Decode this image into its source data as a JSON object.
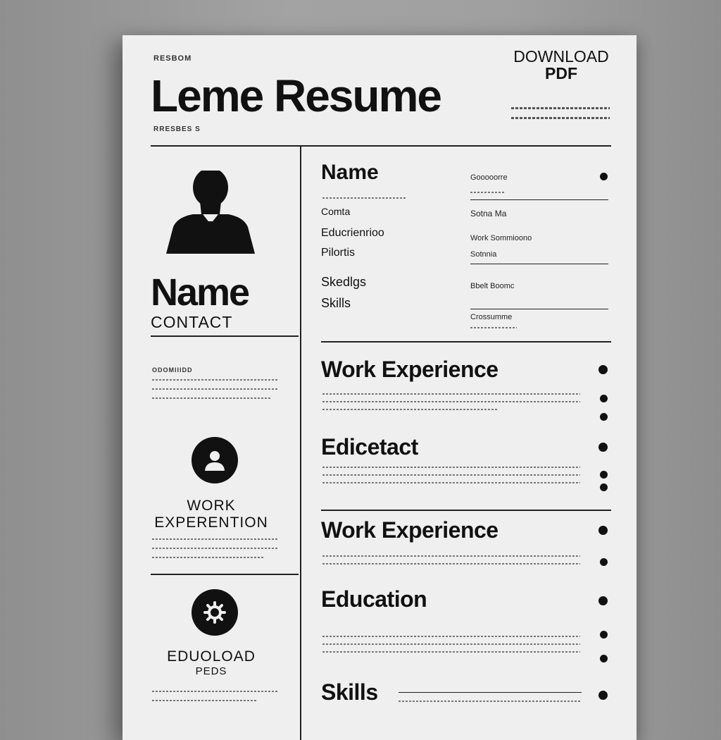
{
  "header": {
    "kicker": "RESBOM",
    "title": "Leme Resume",
    "subline": "RRESBES S",
    "download_line1": "DOWNLOAD",
    "download_line2": "PDF"
  },
  "sidebar": {
    "name": "Name",
    "contact": "CONTACT",
    "section_small": "ODOMIIIDD",
    "work_line1": "WORK",
    "work_line2": "EXPERENTION",
    "download_line1": "EDUOLOAD",
    "download_line2": "PEDS"
  },
  "info": {
    "name_label": "Name",
    "left_fields": [
      "Comta",
      "Educrienrioo",
      "Pilortis",
      "Skedlgs",
      "Skills"
    ],
    "right_fields": [
      "Gooooorre",
      "Sotna Ma",
      "Work Sommioono",
      "Sotnnia",
      "Bbelt Boomc",
      "Crossumme"
    ]
  },
  "main": {
    "sections": [
      {
        "title": "Work Experience"
      },
      {
        "title": "Edicetact"
      },
      {
        "title": "Work Experience"
      },
      {
        "title": "Education"
      },
      {
        "title": "Skills"
      }
    ]
  },
  "colors": {
    "paper": "#efefef",
    "ink": "#111111",
    "background": "#a0a0a0"
  },
  "icons": [
    "person-silhouette-icon",
    "user-circle-icon",
    "gear-circle-icon",
    "bullet-icon"
  ]
}
